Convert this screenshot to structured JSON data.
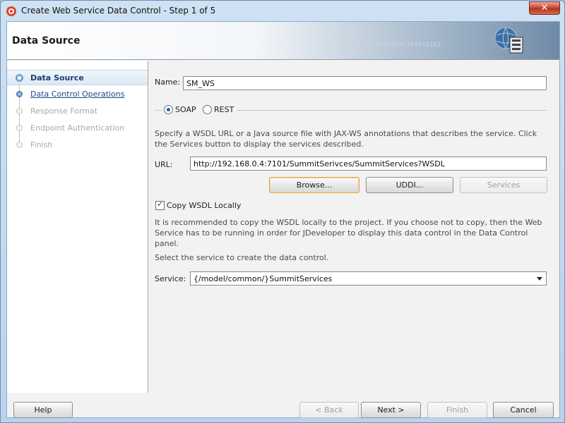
{
  "window": {
    "title": "Create Web Service Data Control - Step 1 of 5",
    "close_glyph": "✕"
  },
  "header": {
    "title": "Data Source",
    "binary_text": "0101101010101101010101",
    "graphic_icon": "globe-icon"
  },
  "steps": [
    {
      "label": "Data Source",
      "state": "active"
    },
    {
      "label": "Data Control Operations",
      "state": "link"
    },
    {
      "label": "Response Format",
      "state": "disabled"
    },
    {
      "label": "Endpoint Authentication",
      "state": "disabled"
    },
    {
      "label": "Finish",
      "state": "disabled"
    }
  ],
  "form": {
    "name_label": "Name:",
    "name_value": "SM_WS",
    "protocol": {
      "soap_label": "SOAP",
      "rest_label": "REST",
      "selected": "SOAP"
    },
    "description": "Specify a WSDL URL or a Java source file with JAX-WS annotations that describes the service. Click the Services button to display the services described.",
    "url_label": "URL:",
    "url_value": "http://192.168.0.4:7101/SummitSerivces/SummitServices?WSDL",
    "browse_label": "Browse...",
    "uddi_label": "UDDI...",
    "services_label": "Services",
    "copy_wsdl_label": "Copy WSDL Locally",
    "copy_wsdl_checked": true,
    "copy_note": "It is recommended to copy the WSDL locally to the project. If you choose not to copy, then the Web Service has to be running in order for JDeveloper to display this data control in the Data Control panel.",
    "select_prompt": "Select the service to create the data control.",
    "service_label": "Service:",
    "service_value": "{/model/common/}SummitServices"
  },
  "footer": {
    "help_label": "Help",
    "back_label": "< Back",
    "next_label": "Next >",
    "finish_label": "Finish",
    "cancel_label": "Cancel"
  },
  "colors": {
    "accent": "#2c5f92",
    "focus_border": "#e0a34a",
    "disabled_text": "#a8a8a8",
    "close_button": "#c4422c"
  }
}
